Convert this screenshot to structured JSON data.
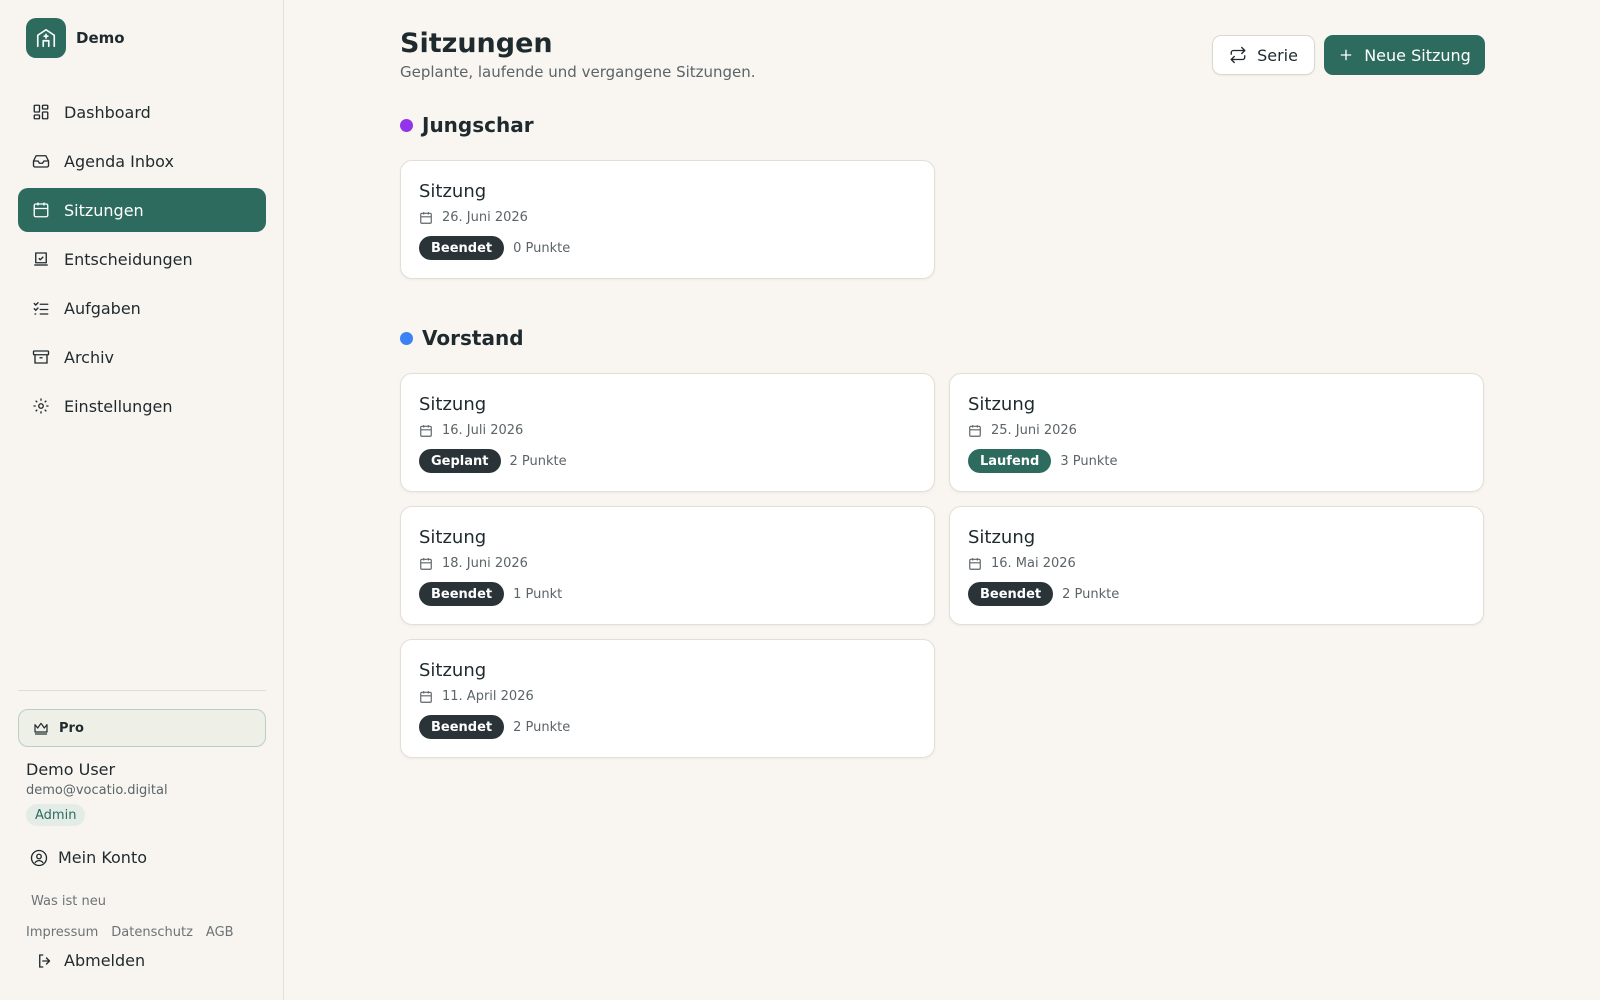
{
  "brand": {
    "name": "Demo"
  },
  "nav": [
    {
      "label": "Dashboard",
      "icon": "dashboard-icon",
      "active": false
    },
    {
      "label": "Agenda Inbox",
      "icon": "inbox-icon",
      "active": false
    },
    {
      "label": "Sitzungen",
      "icon": "calendar-icon",
      "active": true
    },
    {
      "label": "Entscheidungen",
      "icon": "decision-icon",
      "active": false
    },
    {
      "label": "Aufgaben",
      "icon": "checklist-icon",
      "active": false
    },
    {
      "label": "Archiv",
      "icon": "archive-icon",
      "active": false
    },
    {
      "label": "Einstellungen",
      "icon": "gear-icon",
      "active": false
    }
  ],
  "plan": {
    "label": "Pro"
  },
  "user": {
    "name": "Demo User",
    "email": "demo@vocatio.digital",
    "role": "Admin"
  },
  "account": {
    "label": "Mein Konto"
  },
  "whatsnew": "Was ist neu",
  "footer_links": [
    "Impressum",
    "Datenschutz",
    "AGB"
  ],
  "logout": "Abmelden",
  "page": {
    "title": "Sitzungen",
    "subtitle": "Geplante, laufende und vergangene Sitzungen."
  },
  "actions": {
    "series_label": "Serie",
    "new_label": "Neue Sitzung"
  },
  "colors": {
    "accent": "#2e6b5f",
    "jungschar": "#9333ea",
    "vorstand": "#3b82f6",
    "status_dark": "#2a3438"
  },
  "groups": [
    {
      "name": "Jungschar",
      "meetings": [
        {
          "title": "Sitzung",
          "date": "26. Juni 2026",
          "status": "Beendet",
          "points": "0 Punkte"
        }
      ]
    },
    {
      "name": "Vorstand",
      "meetings": [
        {
          "title": "Sitzung",
          "date": "16. Juli 2026",
          "status": "Geplant",
          "points": "2 Punkte"
        },
        {
          "title": "Sitzung",
          "date": "25. Juni 2026",
          "status": "Laufend",
          "points": "3 Punkte"
        },
        {
          "title": "Sitzung",
          "date": "18. Juni 2026",
          "status": "Beendet",
          "points": "1 Punkt"
        },
        {
          "title": "Sitzung",
          "date": "16. Mai 2026",
          "status": "Beendet",
          "points": "2 Punkte"
        },
        {
          "title": "Sitzung",
          "date": "11. April 2026",
          "status": "Beendet",
          "points": "2 Punkte"
        }
      ]
    }
  ]
}
